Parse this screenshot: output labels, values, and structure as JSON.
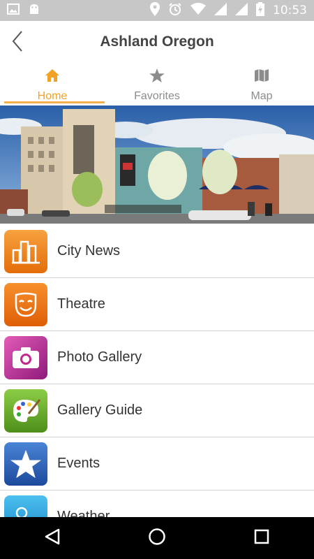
{
  "status_bar": {
    "time": "10:53",
    "icons_left": [
      "image-icon",
      "android-icon"
    ],
    "icons_right": [
      "location-icon",
      "alarm-icon",
      "wifi-icon",
      "signal-icon",
      "signal-icon",
      "battery-icon"
    ]
  },
  "header": {
    "title": "Ashland Oregon",
    "back_icon": "back-chevron-icon"
  },
  "tabs": [
    {
      "label": "Home",
      "icon": "home-icon",
      "active": true
    },
    {
      "label": "Favorites",
      "icon": "star-icon",
      "active": false
    },
    {
      "label": "Map",
      "icon": "map-icon",
      "active": false
    }
  ],
  "hero": {
    "subject": "street-scene-photo"
  },
  "menu": [
    {
      "label": "City News",
      "icon": "city-buildings-icon",
      "color": "#f08a1c"
    },
    {
      "label": "Theatre",
      "icon": "theatre-mask-icon",
      "color": "#f07a14"
    },
    {
      "label": "Photo Gallery",
      "icon": "camera-icon",
      "color": "#c0288c"
    },
    {
      "label": "Gallery Guide",
      "icon": "palette-icon",
      "color": "#6cae2a"
    },
    {
      "label": "Events",
      "icon": "star-icon",
      "color": "#2c62b8"
    },
    {
      "label": "Weather",
      "icon": "weather-icon",
      "color": "#2aa0dc"
    }
  ],
  "colors": {
    "accent": "#f2a226",
    "status_bar": "#c7c7c7",
    "nav_bar": "#000000"
  },
  "nav": [
    "back-nav-icon",
    "home-nav-icon",
    "recents-nav-icon"
  ]
}
